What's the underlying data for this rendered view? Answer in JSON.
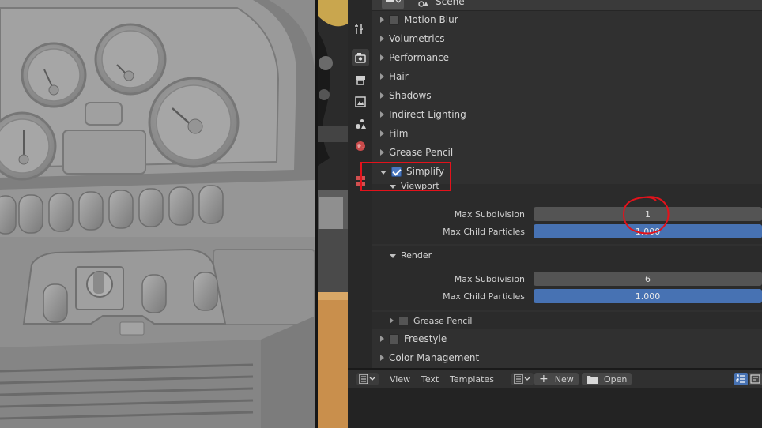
{
  "properties": {
    "header": {
      "scene_label": "Scene",
      "editor_icon": "properties-editor-icon",
      "scene_icon": "scene-icon"
    },
    "tabs": [
      {
        "name": "tool-tab",
        "icon": "tool-icon"
      },
      {
        "name": "render-tab",
        "icon": "render-icon",
        "active": true
      },
      {
        "name": "output-tab",
        "icon": "output-icon"
      },
      {
        "name": "view-layer-tab",
        "icon": "view-layer-icon"
      },
      {
        "name": "scene-tab",
        "icon": "scene-icon"
      },
      {
        "name": "world-tab",
        "icon": "world-icon"
      },
      {
        "name": "texture-tab",
        "icon": "texture-icon"
      }
    ],
    "panels": {
      "motion_blur": "Motion Blur",
      "volumetrics": "Volumetrics",
      "performance": "Performance",
      "hair": "Hair",
      "shadows": "Shadows",
      "indirect_lighting": "Indirect Lighting",
      "film": "Film",
      "grease_pencil": "Grease Pencil",
      "simplify": "Simplify",
      "freestyle": "Freestyle",
      "color_management": "Color Management"
    },
    "simplify": {
      "enabled": true,
      "viewport": {
        "label": "Viewport",
        "max_subdivision_label": "Max Subdivision",
        "max_subdivision": "1",
        "max_child_particles_label": "Max Child Particles",
        "max_child_particles": "1.000"
      },
      "render": {
        "label": "Render",
        "max_subdivision_label": "Max Subdivision",
        "max_subdivision": "6",
        "max_child_particles_label": "Max Child Particles",
        "max_child_particles": "1.000"
      },
      "grease_pencil_label": "Grease Pencil"
    }
  },
  "text_editor": {
    "menu": {
      "view": "View",
      "text": "Text",
      "templates": "Templates"
    },
    "new_label": "New",
    "open_label": "Open",
    "editor_icon": "text-editor-icon",
    "line_numbers_icon": "line-numbers-icon",
    "word_wrap_icon": "word-wrap-icon"
  },
  "colors": {
    "accent": "#4772b3",
    "annotation": "#e3121b",
    "panel_bg": "#303030"
  }
}
